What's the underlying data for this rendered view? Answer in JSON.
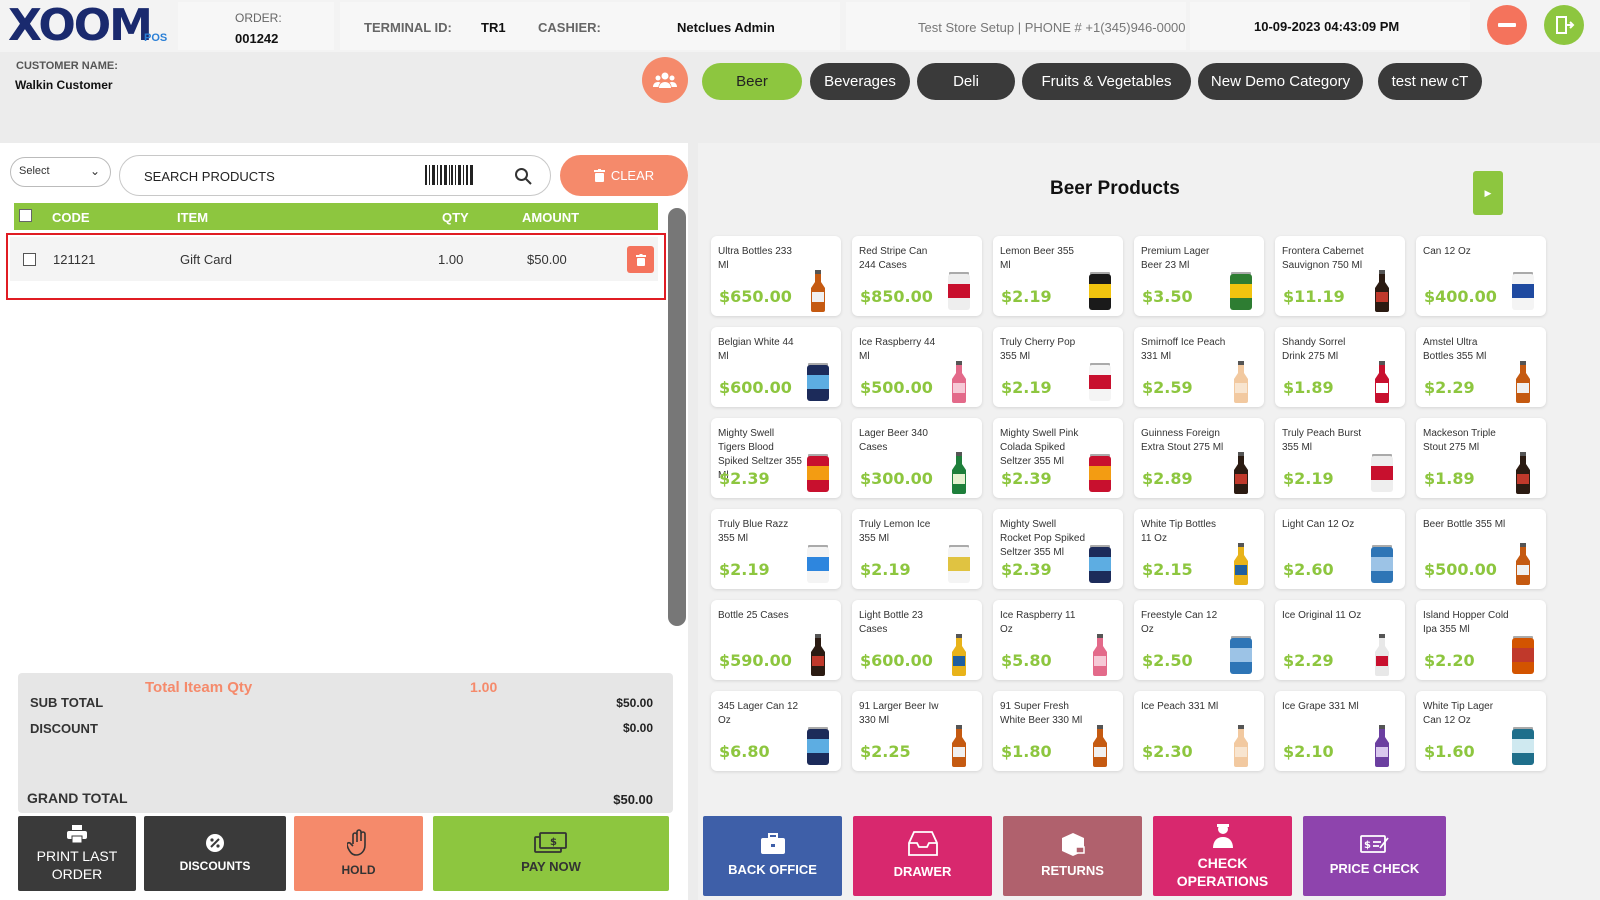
{
  "header": {
    "logo_text": "XOOM",
    "logo_sub": "POS",
    "order_label": "ORDER:",
    "order_number": "001242",
    "terminal_label": "TERMINAL ID:",
    "terminal_value": "TR1",
    "cashier_label": "CASHIER:",
    "cashier_value": "Netclues Admin",
    "store_info": "Test Store Setup | PHONE # +1(345)946-0000",
    "datetime": "10-09-2023 04:43:09 PM"
  },
  "customer": {
    "label": "CUSTOMER NAME:",
    "name": "Walkin Customer"
  },
  "search": {
    "select_value": "Select",
    "placeholder": "SEARCH PRODUCTS",
    "clear_label": "CLEAR"
  },
  "cart": {
    "columns": [
      "CODE",
      "ITEM",
      "QTY",
      "AMOUNT"
    ],
    "rows": [
      {
        "code": "121121",
        "item": "Gift Card",
        "qty": "1.00",
        "amount": "$50.00"
      }
    ]
  },
  "totals": {
    "total_item_qty_label": "Total Iteam Qty",
    "total_item_qty": "1.00",
    "subtotal_label": "SUB TOTAL",
    "subtotal": "$50.00",
    "discount_label": "DISCOUNT",
    "discount": "$0.00",
    "grand_total_label": "GRAND TOTAL",
    "grand_total": "$50.00"
  },
  "actions": {
    "print_last_order": "PRINT LAST ORDER",
    "discounts": "DISCOUNTS",
    "hold": "HOLD",
    "pay_now": "PAY NOW"
  },
  "categories": [
    "Beer",
    "Beverages",
    "Deli",
    "Fruits & Vegetables",
    "New Demo Category",
    "test new cT"
  ],
  "active_category": "Beer",
  "products_title": "Beer Products",
  "products": [
    {
      "name": "Ultra Bottles 233 Ml",
      "price": "$650.00",
      "img": "bottle-amber"
    },
    {
      "name": "Red Stripe Can 244 Cases",
      "price": "$850.00",
      "img": "can-white"
    },
    {
      "name": "Lemon Beer 355 Ml",
      "price": "$2.19",
      "img": "can-black"
    },
    {
      "name": "Premium Lager Beer 23 Ml",
      "price": "$3.50",
      "img": "can-green"
    },
    {
      "name": "Frontera Cabernet Sauvignon  750 Ml",
      "price": "$11.19",
      "img": "bottle-dark"
    },
    {
      "name": "Can 12 Oz",
      "price": "$400.00",
      "img": "can-lite"
    },
    {
      "name": "Belgian White 44 Ml",
      "price": "$600.00",
      "img": "can-navy"
    },
    {
      "name": "Ice Raspberry 44 Ml",
      "price": "$500.00",
      "img": "bottle-pink"
    },
    {
      "name": "Truly Cherry Pop 355 Ml",
      "price": "$2.19",
      "img": "can-red-white"
    },
    {
      "name": "Smirnoff Ice Peach 331 Ml",
      "price": "$2.59",
      "img": "bottle-peach"
    },
    {
      "name": "Shandy Sorrel Drink  275 Ml",
      "price": "$1.89",
      "img": "bottle-red"
    },
    {
      "name": "Amstel Ultra Bottles  355 Ml",
      "price": "$2.29",
      "img": "bottle-amber"
    },
    {
      "name": "Mighty Swell Tigers Blood Spiked Seltzer  355 Ml",
      "price": "$2.39",
      "img": "can-red"
    },
    {
      "name": "Lager Beer 340 Cases",
      "price": "$300.00",
      "img": "bottle-green"
    },
    {
      "name": "Mighty Swell Pink Colada Spiked Seltzer  355 Ml",
      "price": "$2.39",
      "img": "can-red"
    },
    {
      "name": "Guinness Foreign Extra Stout  275 Ml",
      "price": "$2.89",
      "img": "bottle-dark"
    },
    {
      "name": "Truly Peach Burst 355 Ml",
      "price": "$2.19",
      "img": "can-white"
    },
    {
      "name": "Mackeson Triple Stout  275 Ml",
      "price": "$1.89",
      "img": "bottle-dark"
    },
    {
      "name": "Truly Blue Razz 355 Ml",
      "price": "$2.19",
      "img": "can-blue-white"
    },
    {
      "name": "Truly Lemon Ice 355 Ml",
      "price": "$2.19",
      "img": "can-yellow-white"
    },
    {
      "name": "Mighty Swell Rocket Pop Spiked Seltzer  355 Ml",
      "price": "$2.39",
      "img": "can-navy"
    },
    {
      "name": "White Tip Bottles 11 Oz",
      "price": "$2.15",
      "img": "bottle-gold"
    },
    {
      "name": "Light Can 12 Oz",
      "price": "$2.60",
      "img": "can-blue"
    },
    {
      "name": "Beer Bottle 355 Ml",
      "price": "$500.00",
      "img": "bottle-amber"
    },
    {
      "name": "Bottle 25 Cases",
      "price": "$590.00",
      "img": "bottle-dark"
    },
    {
      "name": "Light Bottle 23 Cases",
      "price": "$600.00",
      "img": "bottle-gold"
    },
    {
      "name": "Ice Raspberry 11 Oz",
      "price": "$5.80",
      "img": "bottle-pink"
    },
    {
      "name": "Freestyle Can 12 Oz",
      "price": "$2.50",
      "img": "can-blue"
    },
    {
      "name": "Ice Original 11 Oz",
      "price": "$2.29",
      "img": "bottle-clear"
    },
    {
      "name": "Island Hopper Cold Ipa 355 Ml",
      "price": "$2.20",
      "img": "can-orange"
    },
    {
      "name": "345 Lager Can 12 Oz",
      "price": "$6.80",
      "img": "can-navy"
    },
    {
      "name": "91 Larger Beer Iw 330 Ml",
      "price": "$2.25",
      "img": "bottle-amber"
    },
    {
      "name": "91 Super Fresh White Beer 330 Ml",
      "price": "$1.80",
      "img": "bottle-amber"
    },
    {
      "name": "Ice Peach 331 Ml",
      "price": "$2.30",
      "img": "bottle-peach"
    },
    {
      "name": "Ice Grape 331 Ml",
      "price": "$2.10",
      "img": "bottle-purple"
    },
    {
      "name": "White Tip Lager Can 12 Oz",
      "price": "$1.60",
      "img": "can-teal"
    }
  ],
  "bottom_buttons": {
    "back_office": "BACK OFFICE",
    "drawer": "DRAWER",
    "returns": "RETURNS",
    "check_operations": "CHECK OPERATIONS",
    "price_check": "PRICE CHECK"
  },
  "colors": {
    "accent_green": "#8dc63f",
    "accent_coral": "#f58a6b",
    "dark_tab": "#3a3a3a",
    "back_office": "#3e5fa8",
    "drawer": "#d8286e",
    "returns": "#b0616d",
    "check_operations": "#d8286e",
    "price_check": "#8e44ad"
  }
}
